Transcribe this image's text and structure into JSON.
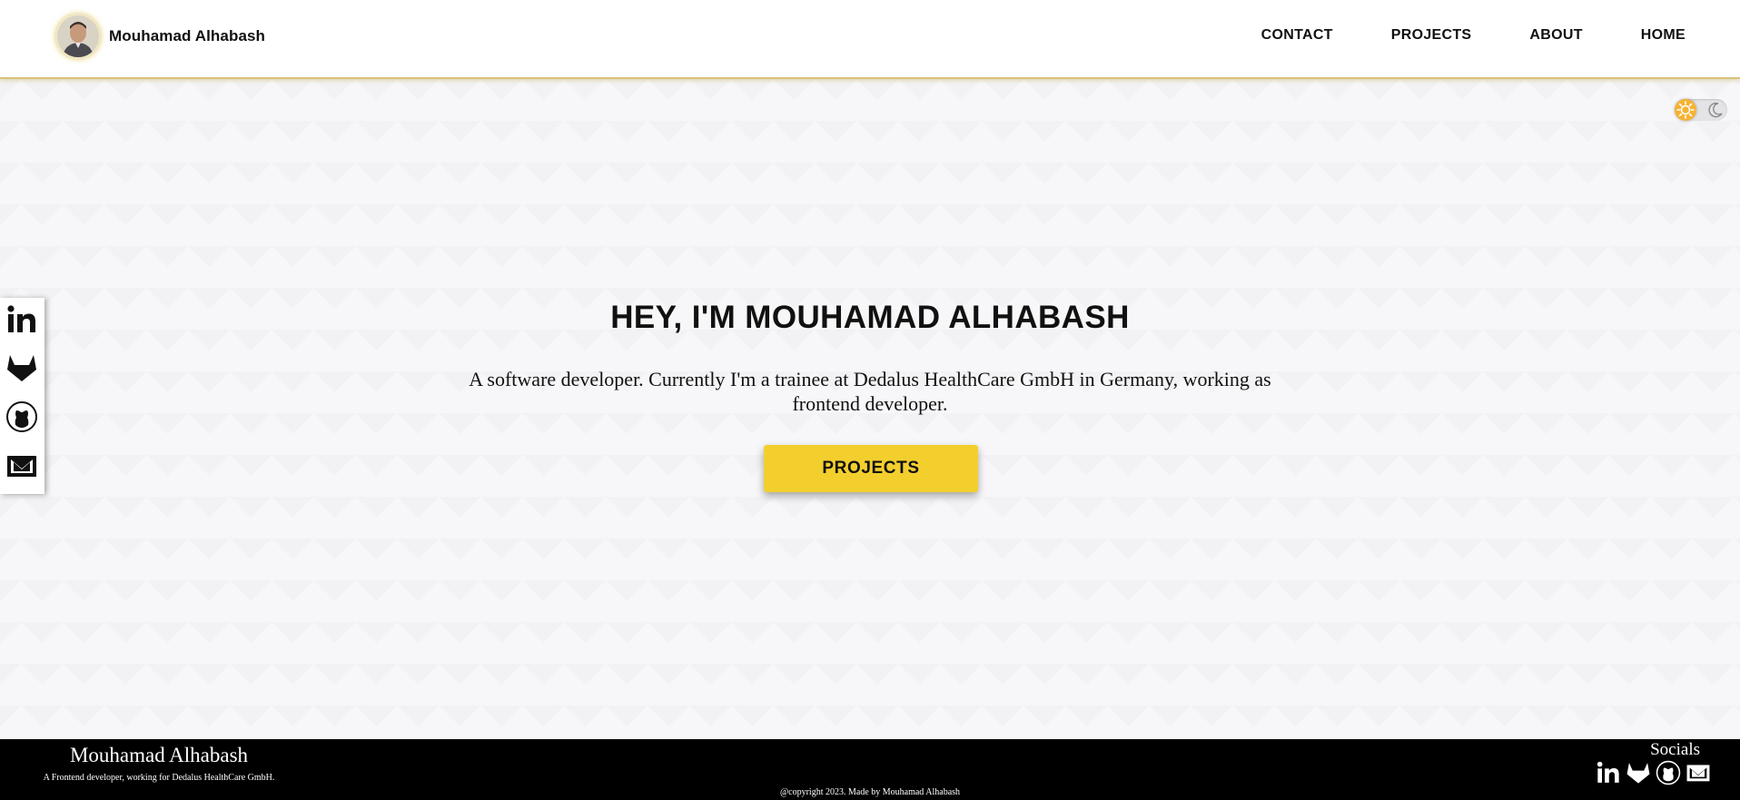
{
  "header": {
    "name": "Mouhamad Alhabash",
    "avatar_alt": "profile-photo",
    "nav": [
      {
        "label": "CONTACT"
      },
      {
        "label": "PROJECTS"
      },
      {
        "label": "ABOUT"
      },
      {
        "label": "HOME"
      }
    ]
  },
  "theme_toggle": {
    "mode": "light",
    "icons": [
      "sun-icon",
      "moon-icon"
    ]
  },
  "hero": {
    "title": "HEY, I'M MOUHAMAD ALHABASH",
    "description": "A software developer. Currently I'm a trainee at Dedalus HealthCare GmbH in Germany, working as frontend developer.",
    "button_label": "PROJECTS"
  },
  "side_socials": {
    "icons": [
      "linkedin-icon",
      "gitlab-icon",
      "github-icon",
      "mail-icon"
    ]
  },
  "footer": {
    "name": "Mouhamad Alhabash",
    "tagline": "A Frontend developer, working for Dedalus HealthCare GmbH.",
    "copyright": "@copyright 2023. Made by Mouhamad Alhabash",
    "socials_title": "Socials",
    "social_icons": [
      "linkedin-icon",
      "gitlab-icon",
      "github-icon",
      "mail-icon"
    ]
  },
  "colors": {
    "accent": "#f3cf2e",
    "header_border": "#d8c27a",
    "background": "#f7f7f9",
    "footer_bg": "#000000",
    "text": "#111111"
  }
}
